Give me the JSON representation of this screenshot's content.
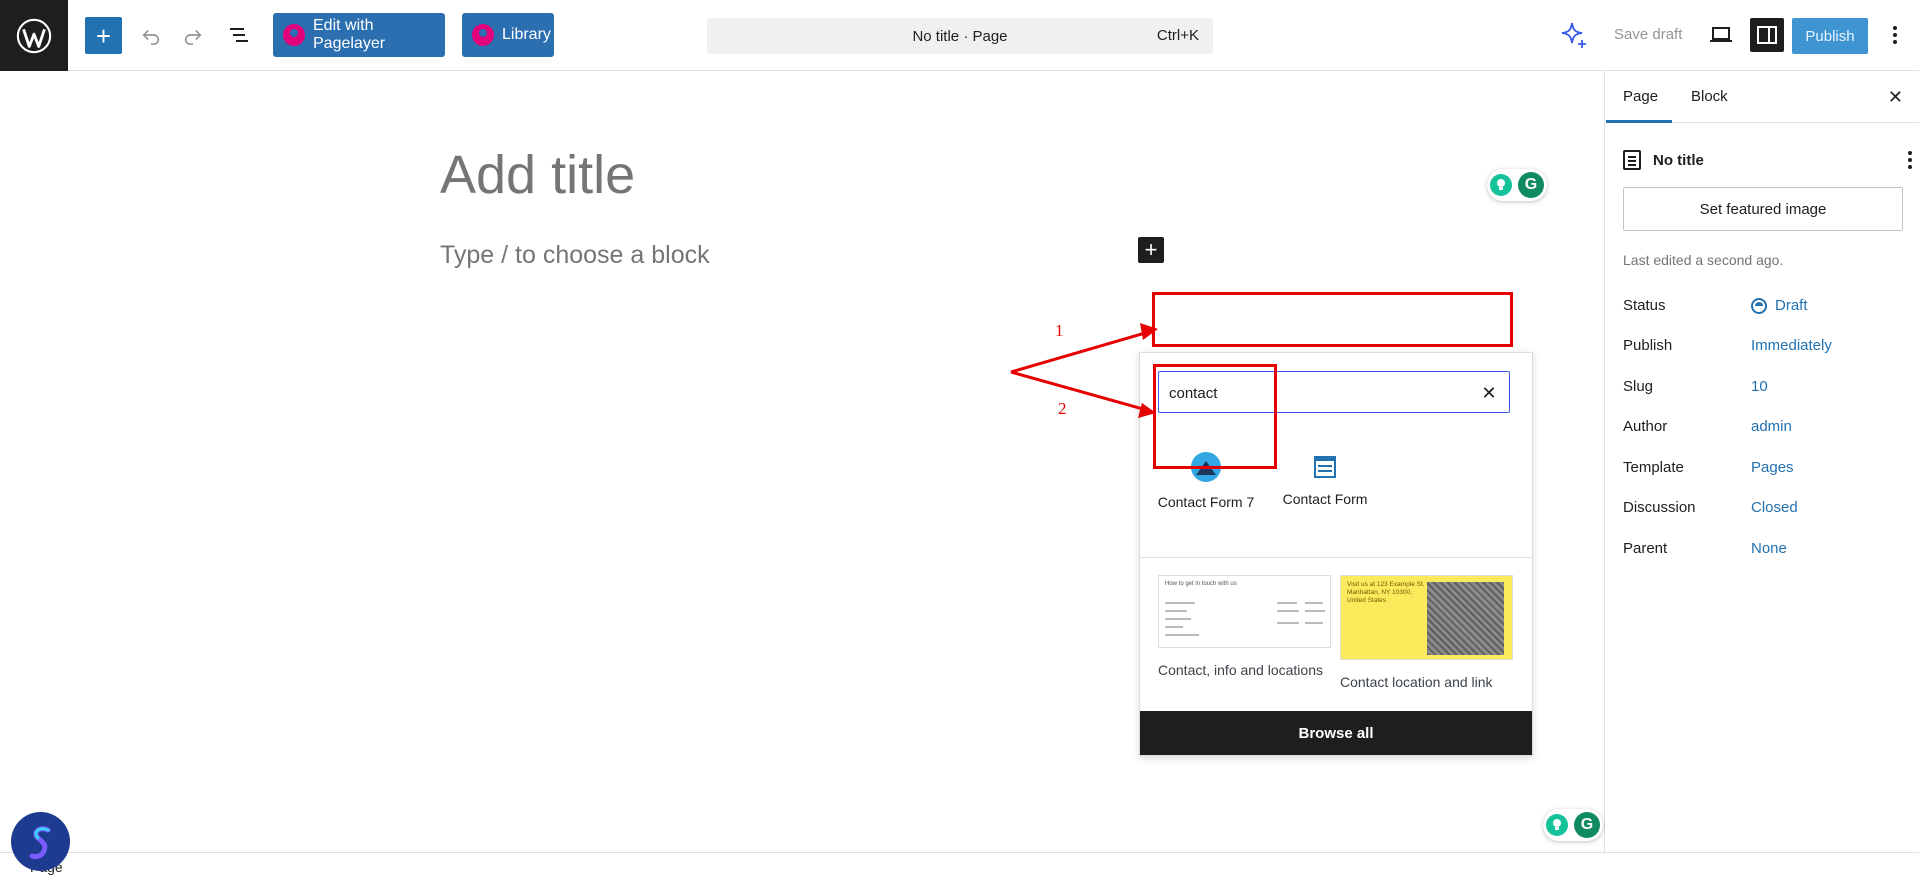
{
  "toolbar": {
    "edit_pagelayer_label": "Edit with Pagelayer",
    "library_label": "Library",
    "command_title": "No title · Page",
    "command_shortcut": "Ctrl+K",
    "save_draft_label": "Save draft",
    "publish_label": "Publish",
    "add_symbol": "+"
  },
  "canvas": {
    "title_placeholder": "Add title",
    "block_placeholder": "Type / to choose a block",
    "inline_add_symbol": "+"
  },
  "inserter": {
    "search_value": "contact",
    "blocks": [
      {
        "label": "Contact Form 7",
        "icon": "contact-form-7-icon"
      },
      {
        "label": "Contact Form",
        "icon": "contact-form-icon"
      }
    ],
    "patterns": [
      {
        "label": "Contact, info and locations",
        "thumb_heading": "How to get in touch with us"
      },
      {
        "label": "Contact location and link",
        "thumb_heading": "Visit us at 123 Example St. Manhattan, NY 10300, United States"
      }
    ],
    "browse_all_label": "Browse all"
  },
  "annotations": {
    "step1": "1",
    "step2": "2",
    "color": "#e60000"
  },
  "sidebar": {
    "tab_page": "Page",
    "tab_block": "Block",
    "doc_title": "No title",
    "featured_image_label": "Set featured image",
    "last_edited": "Last edited a second ago.",
    "properties": [
      {
        "label": "Status",
        "value": "Draft"
      },
      {
        "label": "Publish",
        "value": "Immediately"
      },
      {
        "label": "Slug",
        "value": "10"
      },
      {
        "label": "Author",
        "value": "admin"
      },
      {
        "label": "Template",
        "value": "Pages"
      },
      {
        "label": "Discussion",
        "value": "Closed"
      },
      {
        "label": "Parent",
        "value": "None"
      }
    ]
  },
  "footer": {
    "breadcrumb": "Page"
  },
  "colors": {
    "accent": "#2271b1",
    "pagelayer_pink": "#e3007b",
    "publish_bg": "#3e95d2"
  }
}
